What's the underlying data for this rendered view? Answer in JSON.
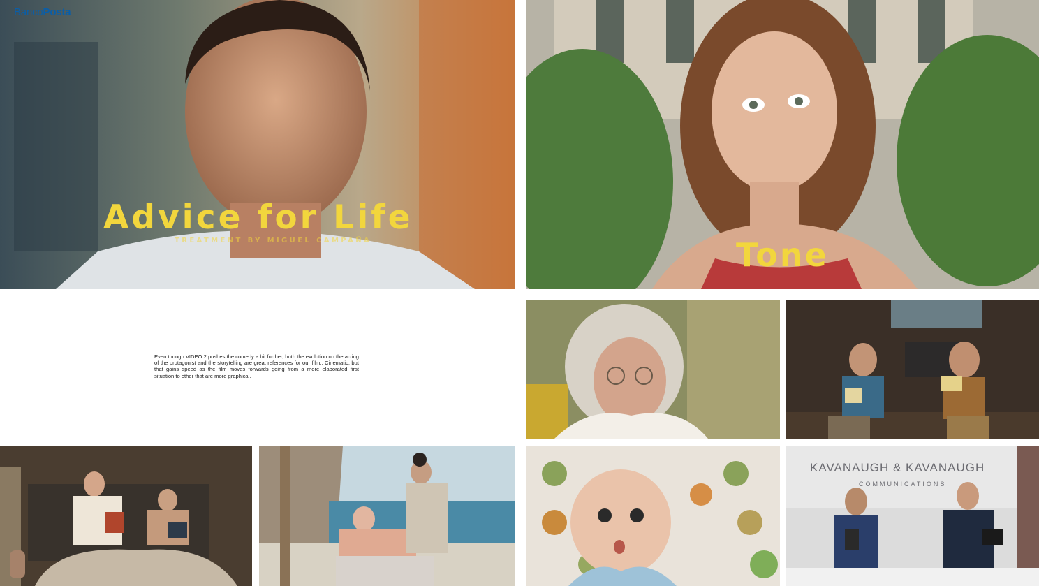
{
  "brand": {
    "prefix": "Banco",
    "name": "Posta"
  },
  "hero": {
    "title": "Advice for Life",
    "subtitle": "TREATMENT BY MIGUEL CAMPAÑA"
  },
  "tone": {
    "title": "Tone"
  },
  "description": "Even though VIDEO 2 pushes the comedy a bit further, both the evolution on the acting of the protagonist and the storytelling are great references for our film.. Cinematic, but that gains speed as the film moves forwards going from a more elaborated first situation to other that are more graphical.",
  "office": {
    "sign": "KAVANAUGH & KAVANAUGH",
    "sign_sub": "COMMUNICATIONS"
  },
  "colors": {
    "accent_yellow": "#f2d63d",
    "brand_blue": "#0a5ea8"
  }
}
